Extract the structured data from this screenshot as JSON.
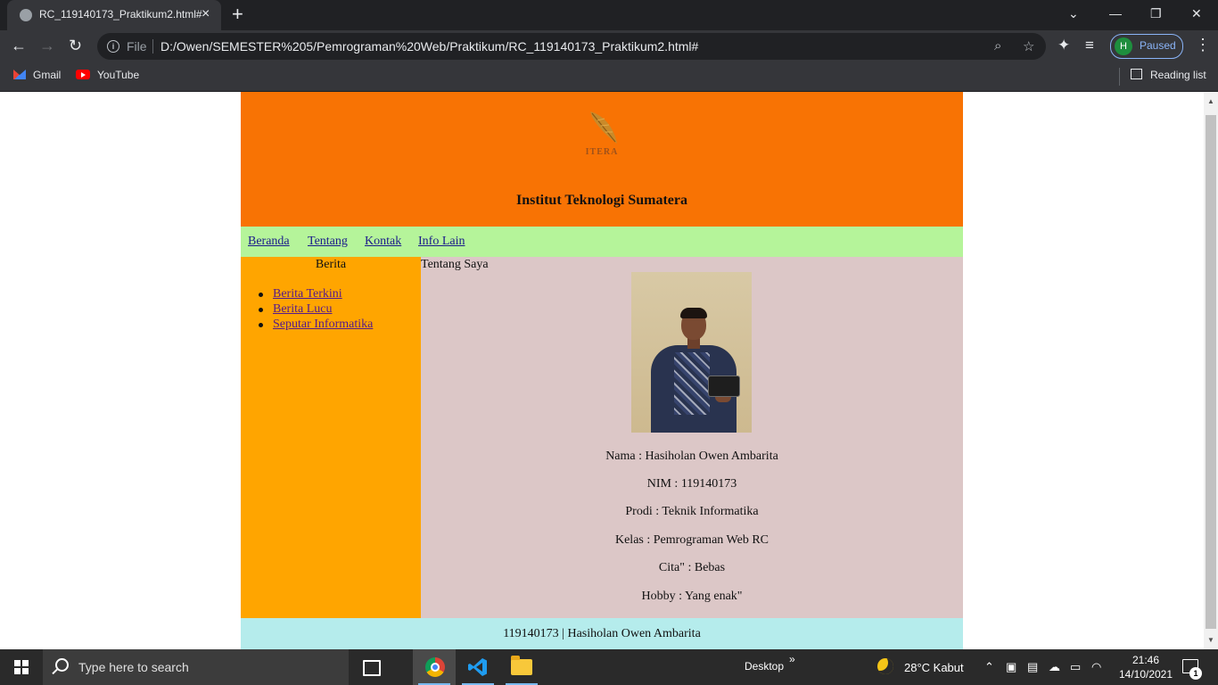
{
  "browser": {
    "tab_title": "RC_119140173_Praktikum2.html#",
    "tab_close_icon": "×",
    "new_tab_icon": "+",
    "window_controls": [
      "⌄",
      "—",
      "❐",
      "✕"
    ],
    "address": {
      "file_label": "File",
      "url": "D:/Owen/SEMESTER%205/Pemrograman%20Web/Praktikum/RC_119140173_Praktikum2.html#"
    },
    "profile": {
      "initial": "H",
      "status": "Paused"
    },
    "bookmarks": [
      {
        "label": "Gmail",
        "icon": "gmail-icon"
      },
      {
        "label": "YouTube",
        "icon": "youtube-icon"
      }
    ],
    "reading_list": "Reading list"
  },
  "page": {
    "logo_text": "ITERA",
    "site_title": "Institut Teknologi Sumatera",
    "nav": [
      "Beranda",
      "Tentang",
      "Kontak",
      "Info Lain"
    ],
    "sidebar": {
      "title": "Berita",
      "links": [
        "Berita Terkini",
        "Berita Lucu",
        "Seputar Informatika"
      ]
    },
    "content": {
      "title": "Tentang Saya",
      "info": [
        "Nama : Hasiholan Owen Ambarita",
        "NIM : 119140173",
        "Prodi : Teknik Informatika",
        "Kelas : Pemrograman Web RC",
        "Cita\" : Bebas",
        "Hobby : Yang enak\""
      ]
    },
    "footer": "119140173 | Hasiholan Owen Ambarita",
    "colors": {
      "header": "#f87304",
      "nav": "#b5f49a",
      "sidebar": "#ffa500",
      "content": "#dcc7c7",
      "footer": "#b5ecec"
    }
  },
  "taskbar": {
    "search_placeholder": "Type here to search",
    "desktop_label": "Desktop",
    "desktop_chevron": "»",
    "weather": "28°C  Kabut",
    "time": "21:46",
    "date": "14/10/2021",
    "notification_count": "1"
  }
}
